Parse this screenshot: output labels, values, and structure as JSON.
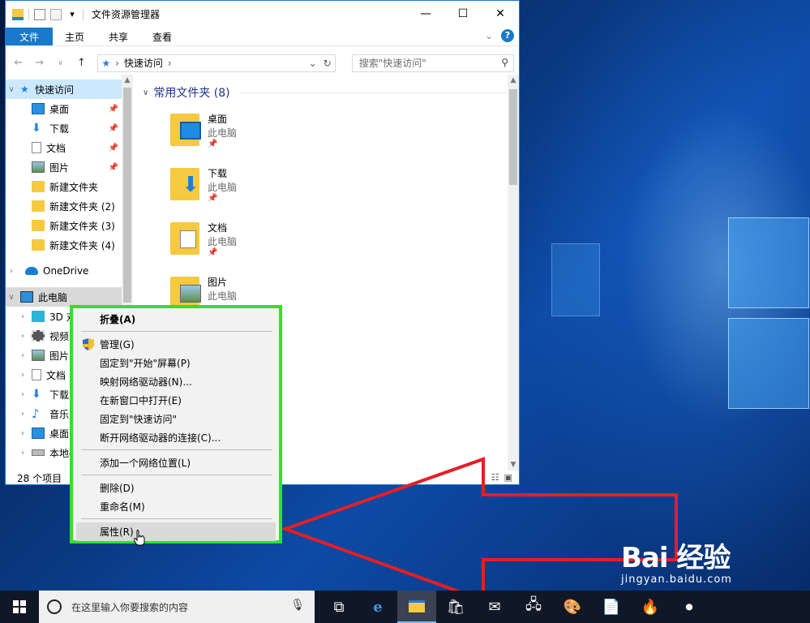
{
  "window": {
    "title": "文件资源管理器",
    "controls": {
      "minimize": "—",
      "maximize": "☐",
      "close": "✕"
    },
    "ribbon": {
      "file": "文件",
      "tabs": [
        "主页",
        "共享",
        "查看"
      ],
      "help": "?"
    },
    "address": {
      "path": "快速访问",
      "search_placeholder": "搜索\"快速访问\""
    },
    "nav_pane": {
      "quick_access": "快速访问",
      "quick_items": [
        {
          "label": "桌面",
          "icon": "desktop-icon"
        },
        {
          "label": "下载",
          "icon": "download-icon"
        },
        {
          "label": "文档",
          "icon": "document-icon"
        },
        {
          "label": "图片",
          "icon": "picture-icon"
        },
        {
          "label": "新建文件夹",
          "icon": "folder-icon"
        },
        {
          "label": "新建文件夹 (2)",
          "icon": "folder-icon"
        },
        {
          "label": "新建文件夹 (3)",
          "icon": "folder-icon"
        },
        {
          "label": "新建文件夹 (4)",
          "icon": "folder-icon"
        }
      ],
      "onedrive": "OneDrive",
      "this_pc": "此电脑",
      "pc_items": [
        {
          "label": "3D 对象",
          "icon": "3d-objects-icon"
        },
        {
          "label": "视频",
          "icon": "video-icon"
        },
        {
          "label": "图片",
          "icon": "picture-icon"
        },
        {
          "label": "文档",
          "icon": "document-icon"
        },
        {
          "label": "下载",
          "icon": "download-icon"
        },
        {
          "label": "音乐",
          "icon": "music-icon"
        },
        {
          "label": "桌面",
          "icon": "desktop-icon"
        },
        {
          "label": "本地磁盘",
          "icon": "disk-icon"
        }
      ]
    },
    "content": {
      "group_title": "常用文件夹 (8)",
      "tiles": [
        {
          "name": "桌面",
          "sub": "此电脑"
        },
        {
          "name": "下载",
          "sub": "此电脑"
        },
        {
          "name": "文档",
          "sub": "此电脑"
        },
        {
          "name": "图片",
          "sub": "此电脑"
        }
      ]
    },
    "status": "28 个项目"
  },
  "context_menu": {
    "items": [
      "折叠(A)",
      "管理(G)",
      "固定到\"开始\"屏幕(P)",
      "映射网络驱动器(N)...",
      "在新窗口中打开(E)",
      "固定到\"快速访问\"",
      "断开网络驱动器的连接(C)...",
      "添加一个网络位置(L)",
      "删除(D)",
      "重命名(M)",
      "属性(R)"
    ],
    "highlighted": "属性(R)"
  },
  "taskbar": {
    "search_placeholder": "在这里输入你要搜索的内容"
  },
  "watermark": {
    "brand": "Bai 经验",
    "url": "jingyan.baidu.com"
  },
  "colors": {
    "accent": "#1979ca",
    "highlight_box": "#2fe12f",
    "arrow": "#e51e25",
    "selection": "#cce8ff"
  }
}
